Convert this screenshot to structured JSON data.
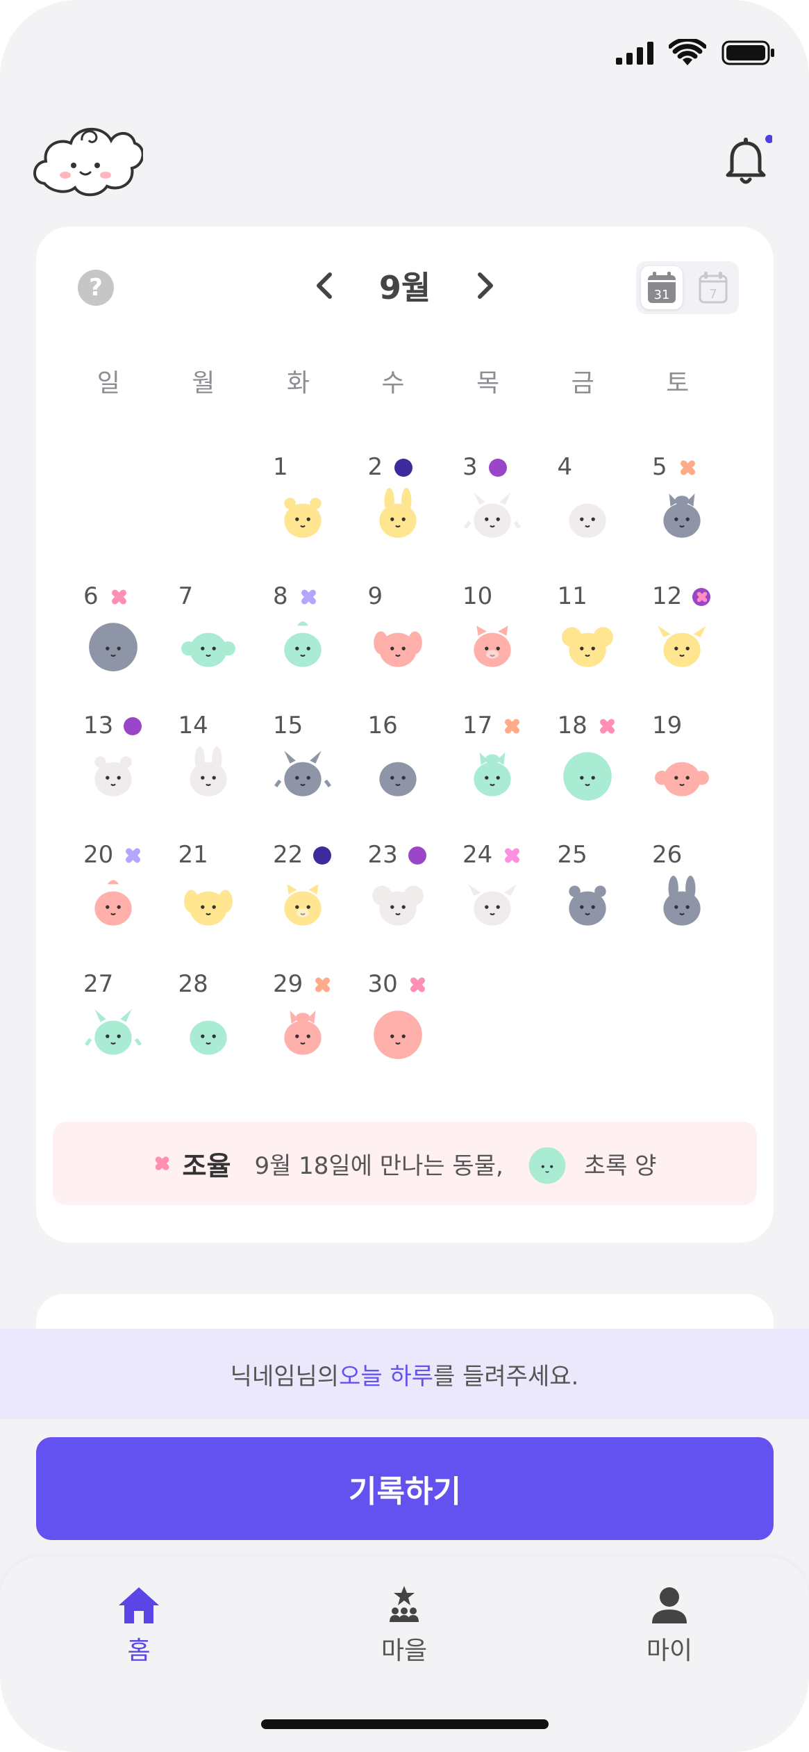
{
  "header": {
    "logo": "cloud-mascot-logo",
    "notification": "bell-icon",
    "notification_badge_color": "#4b3fe0"
  },
  "calendar": {
    "month_label": "9월",
    "weekdays": [
      "일",
      "월",
      "화",
      "수",
      "목",
      "금",
      "토"
    ],
    "days": [
      {
        "d": "1",
        "mark": null,
        "animal": "yellow-tiger"
      },
      {
        "d": "2",
        "mark": "dot-navy",
        "animal": "yellow-rabbit"
      },
      {
        "d": "3",
        "mark": "dot-purple",
        "animal": "white-dragon"
      },
      {
        "d": "4",
        "mark": null,
        "animal": "white-snake"
      },
      {
        "d": "5",
        "mark": "cross-orange",
        "animal": "gray-horse"
      },
      {
        "d": "6",
        "mark": "cross-pink",
        "animal": "gray-sheep"
      },
      {
        "d": "7",
        "mark": null,
        "animal": "mint-monkey"
      },
      {
        "d": "8",
        "mark": "cross-lavender",
        "animal": "mint-rooster"
      },
      {
        "d": "9",
        "mark": null,
        "animal": "pink-dog"
      },
      {
        "d": "10",
        "mark": null,
        "animal": "pink-pig"
      },
      {
        "d": "11",
        "mark": null,
        "animal": "yellow-mouse"
      },
      {
        "d": "12",
        "mark": "ring-purple",
        "animal": "yellow-ox"
      },
      {
        "d": "13",
        "mark": "dot-purple",
        "animal": "white-tiger"
      },
      {
        "d": "14",
        "mark": null,
        "animal": "white-rabbit"
      },
      {
        "d": "15",
        "mark": null,
        "animal": "gray-dragon"
      },
      {
        "d": "16",
        "mark": null,
        "animal": "gray-snake"
      },
      {
        "d": "17",
        "mark": "cross-orange",
        "animal": "mint-horse"
      },
      {
        "d": "18",
        "mark": "cross-pink",
        "animal": "mint-sheep"
      },
      {
        "d": "19",
        "mark": null,
        "animal": "pink-monkey"
      },
      {
        "d": "20",
        "mark": "cross-lavender",
        "animal": "pink-rooster"
      },
      {
        "d": "21",
        "mark": null,
        "animal": "yellow-dog"
      },
      {
        "d": "22",
        "mark": "dot-navy",
        "animal": "yellow-pig"
      },
      {
        "d": "23",
        "mark": "dot-purple",
        "animal": "white-mouse"
      },
      {
        "d": "24",
        "mark": "cross-magenta",
        "animal": "white-ox"
      },
      {
        "d": "25",
        "mark": null,
        "animal": "gray-tiger"
      },
      {
        "d": "26",
        "mark": null,
        "animal": "gray-rabbit"
      },
      {
        "d": "27",
        "mark": null,
        "animal": "mint-dragon"
      },
      {
        "d": "28",
        "mark": null,
        "animal": "mint-snake"
      },
      {
        "d": "29",
        "mark": "cross-orange",
        "animal": "pink-horse"
      },
      {
        "d": "30",
        "mark": "cross-pink",
        "animal": "pink-sheep"
      }
    ],
    "first_weekday_index": 2,
    "view_toggle": {
      "month_icon_text": "31",
      "week_icon_text": "7"
    }
  },
  "info": {
    "name": "조율",
    "text": "9월 18일에 만나는 동물,",
    "animal": "mint-sheep",
    "animal_name": "초록 양"
  },
  "prompt": {
    "prefix": "닉네임님의 ",
    "highlight": "오늘 하루",
    "suffix": "를 들려주세요."
  },
  "record_button": "기록하기",
  "tabs": [
    {
      "label": "홈",
      "icon": "home-icon",
      "active": true
    },
    {
      "label": "마을",
      "icon": "village-icon",
      "active": false
    },
    {
      "label": "마이",
      "icon": "person-icon",
      "active": false
    }
  ],
  "colors": {
    "accent": "#6452f0",
    "mark_navy": "#3e2a9b",
    "mark_purple": "#9b46c9",
    "mark_orange": "#ffab8a",
    "mark_pink": "#ff8fb3",
    "mark_lavender": "#b3a6ff",
    "mark_magenta": "#ff8fe0",
    "tone_yellow": "#ffe58f",
    "tone_white": "#efeceb",
    "tone_gray": "#8d95a6",
    "tone_mint": "#a9ecd3",
    "tone_pink": "#ffb0aa"
  }
}
